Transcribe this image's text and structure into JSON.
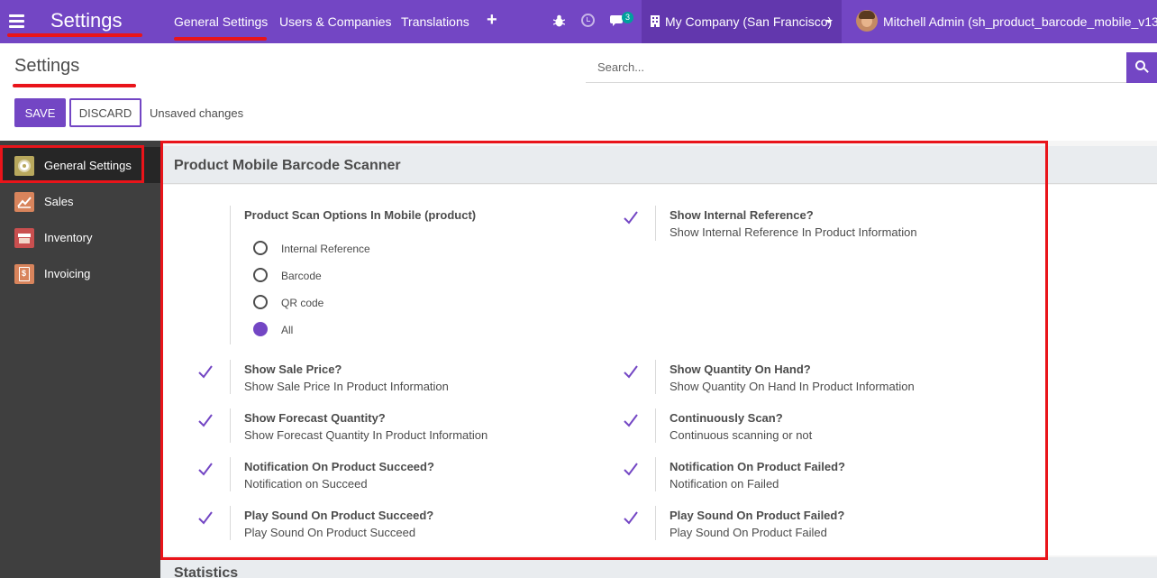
{
  "navbar": {
    "app_title": "Settings",
    "menu_items": [
      {
        "label": "General Settings"
      },
      {
        "label": "Users & Companies"
      },
      {
        "label": "Translations"
      }
    ],
    "plus_icon": "+",
    "chat_badge": "3",
    "company": "My Company (San Francisco)",
    "user": "Mitchell Admin (sh_product_barcode_mobile_v13)"
  },
  "control_panel": {
    "title": "Settings",
    "search_placeholder": "Search...",
    "save_label": "SAVE",
    "discard_label": "DISCARD",
    "status": "Unsaved changes"
  },
  "sidebar": {
    "items": [
      {
        "label": "General Settings",
        "icon": "gear-icon",
        "color": "#b8a85d"
      },
      {
        "label": "Sales",
        "icon": "chart-icon",
        "color": "#d8845c"
      },
      {
        "label": "Inventory",
        "icon": "box-icon",
        "color": "#c94f4f"
      },
      {
        "label": "Invoicing",
        "icon": "invoice-icon",
        "color": "#d8845c"
      }
    ]
  },
  "section": {
    "title": "Product Mobile Barcode Scanner",
    "scan_options": {
      "title": "Product Scan Options In Mobile (product)",
      "options": [
        "Internal Reference",
        "Barcode",
        "QR code",
        "All"
      ],
      "selected": "All"
    },
    "settings": [
      {
        "title": "Show Internal Reference?",
        "desc": "Show Internal Reference In Product Information",
        "checked": true
      },
      {
        "title": "Show Sale Price?",
        "desc": "Show Sale Price In Product Information",
        "checked": true
      },
      {
        "title": "Show Quantity On Hand?",
        "desc": "Show Quantity On Hand In Product Information",
        "checked": true
      },
      {
        "title": "Show Forecast Quantity?",
        "desc": "Show Forecast Quantity In Product Information",
        "checked": true
      },
      {
        "title": "Continuously Scan?",
        "desc": "Continuous scanning or not",
        "checked": true
      },
      {
        "title": "Notification On Product Succeed?",
        "desc": "Notification on Succeed",
        "checked": true
      },
      {
        "title": "Notification On Product Failed?",
        "desc": "Notification on Failed",
        "checked": true
      },
      {
        "title": "Play Sound On Product Succeed?",
        "desc": "Play Sound On Product Succeed",
        "checked": true
      },
      {
        "title": "Play Sound On Product Failed?",
        "desc": "Play Sound On Product Failed",
        "checked": true
      }
    ]
  },
  "section2": {
    "title": "Statistics"
  },
  "colors": {
    "brand": "#7346c4",
    "brand_dark": "#6237ad",
    "highlight": "#e9141a",
    "sidebar_bg": "#3f3f3f"
  }
}
